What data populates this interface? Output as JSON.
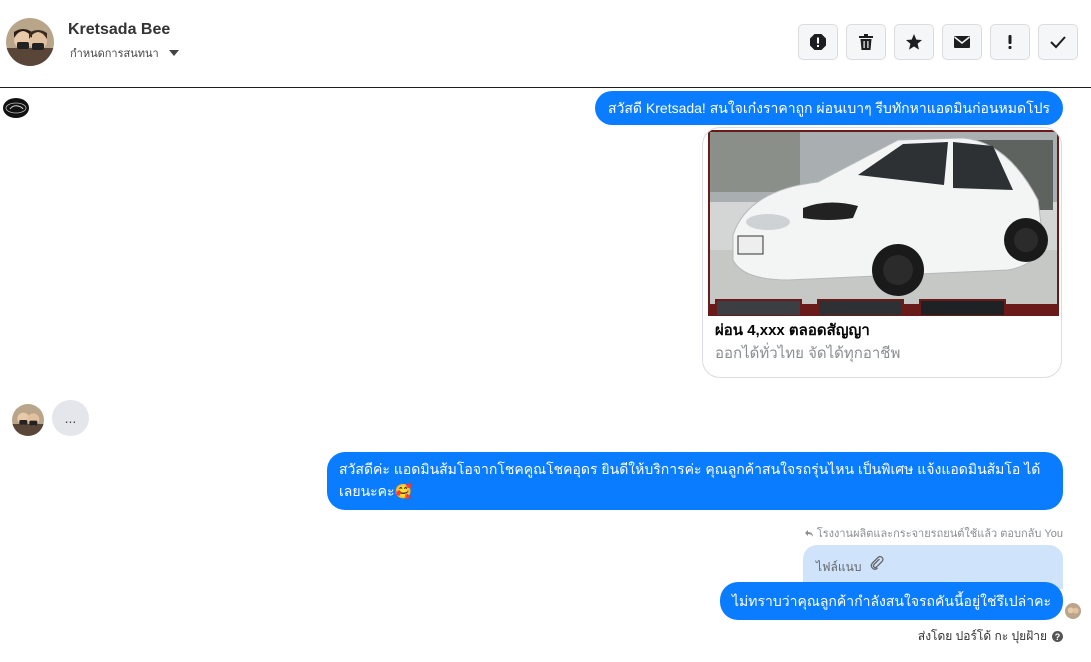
{
  "header": {
    "name": "Kretsada Bee",
    "subtitle": "กำหนดการสนทนา",
    "actions": [
      {
        "name": "spam-icon"
      },
      {
        "name": "trash-icon"
      },
      {
        "name": "star-icon"
      },
      {
        "name": "mail-icon"
      },
      {
        "name": "exclamation-icon"
      },
      {
        "name": "check-icon"
      }
    ]
  },
  "messages": {
    "m1": "สวัสดี Kretsada! สนใจเก๋งราคาถูก ผ่อนเบาๆ รีบทักหาแอดมินก่อนหมดโปร",
    "card": {
      "image_icon": "white-sedan-car-photo",
      "title": "ผ่อน 4,xxx ตลอดสัญญา",
      "subtitle": "ออกได้ทั่วไทย จัดได้ทุกอาชีพ"
    },
    "typing": "...",
    "m2": "สวัสดีค่ะ แอดมินส้มโอจากโชคคูณโชคอุดร ยินดีให้บริการค่ะ  คุณลูกค้าสนใจรถรุ่นไหน เป็นพิเศษ แจ้งแอดมินส้มโอ ได้เลยนะคะ🥰",
    "reply_meta": "โรงงานผลิตและกระจายรถยนต์ใช้แล้ว ตอบกลับ You",
    "attachment_label": "ไฟล์แนบ",
    "m3": "ไม่ทราบว่าคุณลูกค้ากำลังสนใจรถคันนี้อยู่ใช่รึเปล่าคะ",
    "sent_by": "ส่งโดย ปอร์โด้ กะ ปุยฝ้าย",
    "help": "?"
  },
  "colors": {
    "accent": "#0a7cff",
    "attachment_bg": "#cfe3fb",
    "typing_bg": "#e4e6eb"
  }
}
